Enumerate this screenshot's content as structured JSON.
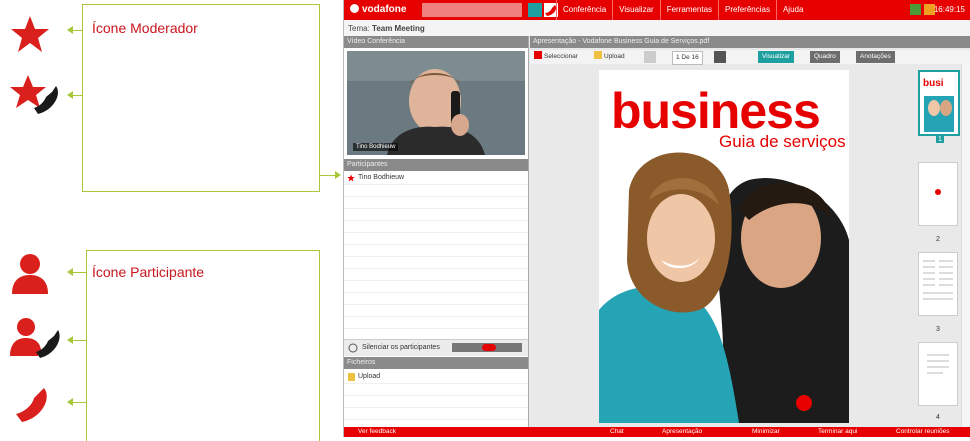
{
  "legend": {
    "moderator_label": "Ícone Moderador",
    "participant_label": "Ícone Participante",
    "icons": [
      "moderator-star-icon",
      "moderator-phone-icon",
      "participant-person-icon",
      "participant-phone-icon",
      "phone-icon"
    ]
  },
  "colors": {
    "brand_red": "#e60000",
    "callout_green": "#a8c83a",
    "teal": "#1fa0a0"
  },
  "app": {
    "brand": "vodafone",
    "menu": [
      "Conferência",
      "Visualizar",
      "Ferramentas",
      "Preferências",
      "Ajuda"
    ],
    "clock": "16:49:15",
    "subbar_label": "Tema:",
    "subbar_value": "Team Meeting",
    "video_section": "Vídeo Conferência",
    "video_name": "Tino Bodhieuw",
    "participants_section": "Participantes",
    "participants": [
      "Tino Bodhieuw"
    ],
    "mute_label": "Silenciar os participantes",
    "files_section": "Ficheiros",
    "files": [
      "Upload"
    ],
    "doc_title": "Apresentação - Vodafone Business Guia de Serviços.pdf",
    "doc_toolbar": {
      "select": "Seleccionar",
      "upload": "Upload",
      "page": "1 De 16",
      "view": "Visualizar",
      "share": "Quadro",
      "tools": "Anotações"
    },
    "cover": {
      "headline": "business",
      "subtitle": "Guia de serviços"
    },
    "thumb_numbers": [
      "1",
      "2",
      "3",
      "4"
    ],
    "bottom": [
      "Ver feedback",
      "Chat",
      "Apresentação",
      "Minimizar",
      "Terminar aqui",
      "Controlar reuniões"
    ]
  }
}
